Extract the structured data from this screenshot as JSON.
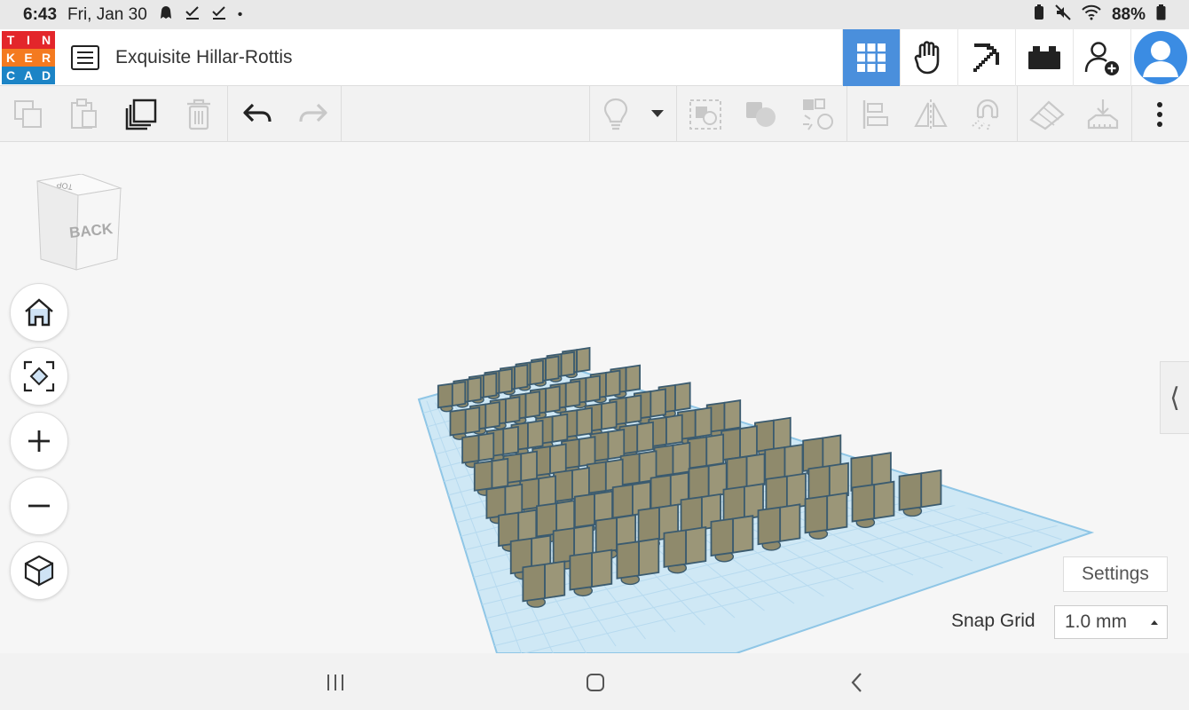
{
  "status_bar": {
    "time": "6:43",
    "date": "Fri, Jan 30",
    "dot": "•",
    "battery": "88%"
  },
  "logo": {
    "letters": [
      "T",
      "I",
      "N",
      "K",
      "E",
      "R",
      "C",
      "A",
      "D"
    ],
    "colors": [
      "#e3262b",
      "#e3262b",
      "#e3262b",
      "#f47a20",
      "#f47a20",
      "#f47a20",
      "#1c84c6",
      "#1c84c6",
      "#1c84c6"
    ]
  },
  "header": {
    "project_title": "Exquisite Hillar-Rottis",
    "accent": "#4a8fdc"
  },
  "viewcube": {
    "face_label": "BACK",
    "top_label": "TOP"
  },
  "collapse_panel": {
    "glyph": "⟨"
  },
  "bottom_right": {
    "settings_label": "Settings",
    "snap_grid_label": "Snap Grid",
    "snap_grid_value": "1.0 mm"
  },
  "workplane": {
    "plate_color": "#cfe8f5",
    "object_color": "#8f8a6c",
    "object_edge": "#3b5b6f"
  }
}
